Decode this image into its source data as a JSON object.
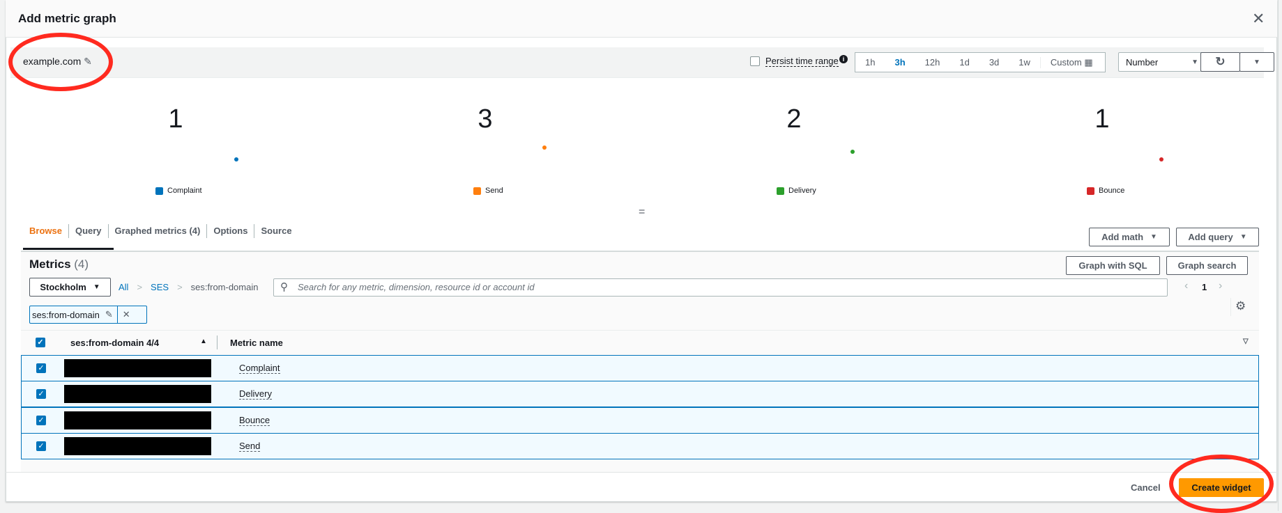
{
  "modal": {
    "title": "Add metric graph",
    "close_icon": "close-icon"
  },
  "graph": {
    "name": "example.com",
    "persist_label": "Persist time range",
    "time_ranges": [
      "1h",
      "3h",
      "12h",
      "1d",
      "3d",
      "1w"
    ],
    "custom_label": "Custom",
    "selected_range": "3h",
    "view_type": "Number"
  },
  "metrics_widget": {
    "items": [
      {
        "label": "Complaint",
        "value": "1",
        "color": "#0073bb"
      },
      {
        "label": "Send",
        "value": "3",
        "color": "#ff7f0e"
      },
      {
        "label": "Delivery",
        "value": "2",
        "color": "#2ca02c"
      },
      {
        "label": "Bounce",
        "value": "1",
        "color": "#d62728"
      }
    ]
  },
  "tabs": [
    "Browse",
    "Query",
    "Graphed metrics (4)",
    "Options",
    "Source"
  ],
  "toolbar": {
    "add_math": "Add math",
    "add_query": "Add query",
    "graph_sql": "Graph with SQL",
    "graph_search": "Graph search"
  },
  "browse": {
    "heading": "Metrics",
    "count": "(4)",
    "region": "Stockholm",
    "breadcrumb": [
      "All",
      "SES",
      "ses:from-domain"
    ],
    "search_placeholder": "Search for any metric, dimension, resource id or account id",
    "page": "1",
    "filter_chip": "ses:from-domain"
  },
  "table": {
    "col1": "ses:from-domain 4/4",
    "col2": "Metric name",
    "rows": [
      "Complaint",
      "Delivery",
      "Bounce",
      "Send"
    ]
  },
  "footer": {
    "cancel": "Cancel",
    "create": "Create widget"
  }
}
